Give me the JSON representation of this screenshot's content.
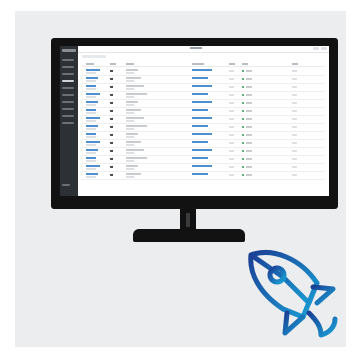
{
  "colors": {
    "background": "#ecedef",
    "monitor": "#121212",
    "sidebar": "#2d3035",
    "link": "#4e8fcf",
    "rocket_gradient": [
      "#1b3f95",
      "#1aa1d6"
    ]
  },
  "icons": {
    "monitor": "desktop-monitor-icon",
    "rocket": "rocket-icon"
  }
}
